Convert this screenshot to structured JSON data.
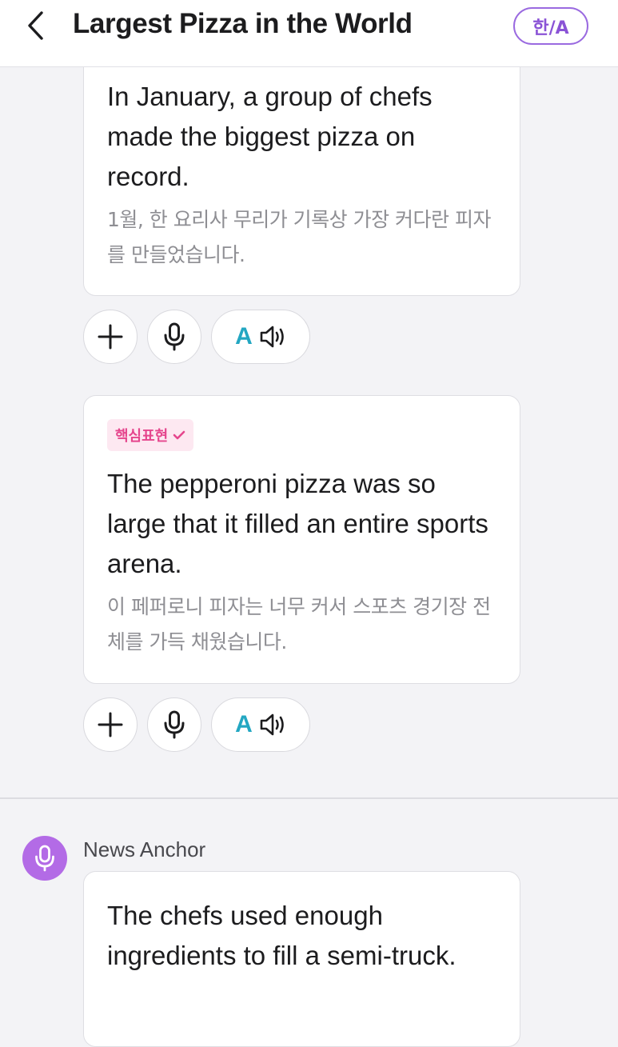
{
  "header": {
    "title": "Largest Pizza in the World",
    "lang_toggle": "한/A"
  },
  "messages": [
    {
      "english": "In January, a group of chefs made the biggest pizza on record.",
      "korean": "1월, 한 요리사 무리가 기록상 가장 커다란 피자를 만들었습니다."
    },
    {
      "badge": "핵심표현",
      "english": "The pepperoni pizza was so large that it filled an entire sports arena.",
      "korean": "이 페퍼로니 피자는 너무 커서 스포츠 경기장 전체를 가득 채웠습니다."
    }
  ],
  "actions": {
    "add_icon": "plus-icon",
    "record_icon": "microphone-icon",
    "audio_label": "A",
    "audio_icon": "speaker-icon"
  },
  "next_message": {
    "speaker": "News Anchor",
    "english": "The chefs used enough ingredients to fill a semi-truck."
  },
  "colors": {
    "accent_purple": "#8a53d6",
    "avatar_purple": "#b36be6",
    "badge_pink": "#e5468d",
    "audio_teal": "#23a7c2"
  }
}
